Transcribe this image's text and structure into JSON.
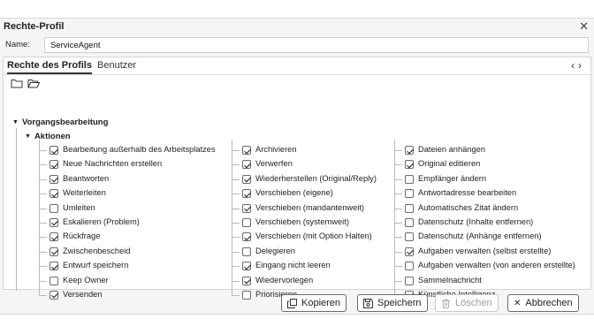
{
  "window": {
    "title": "Rechte-Profil",
    "close_icon": "close-icon"
  },
  "name_field": {
    "label": "Name:",
    "value": "ServiceAgent"
  },
  "tabs": [
    {
      "label": "Rechte des Profils",
      "active": true
    },
    {
      "label": "Benutzer",
      "active": false
    }
  ],
  "nav": {
    "prev": "‹",
    "next": "›"
  },
  "tree": {
    "group": "Vorgangsbearbeitung",
    "subgroup": "Aktionen",
    "columns": [
      [
        {
          "label": "Bearbeitung außerhalb des Arbeitsplatzes",
          "checked": true
        },
        {
          "label": "Neue Nachrichten erstellen",
          "checked": true
        },
        {
          "label": "Beantworten",
          "checked": true
        },
        {
          "label": "Weiterleiten",
          "checked": true
        },
        {
          "label": "Umleiten",
          "checked": false
        },
        {
          "label": "Eskalieren (Problem)",
          "checked": true
        },
        {
          "label": "Rückfrage",
          "checked": true
        },
        {
          "label": "Zwischenbescheid",
          "checked": true
        },
        {
          "label": "Entwurf speichern",
          "checked": true
        },
        {
          "label": "Keep Owner",
          "checked": false
        },
        {
          "label": "Versenden",
          "checked": true
        }
      ],
      [
        {
          "label": "Archivieren",
          "checked": true
        },
        {
          "label": "Verwerfen",
          "checked": true
        },
        {
          "label": "Wiederherstellen (Original/Reply)",
          "checked": true
        },
        {
          "label": "Verschieben (eigene)",
          "checked": true
        },
        {
          "label": "Verschieben (mandantenweit)",
          "checked": true
        },
        {
          "label": "Verschieben (systemweit)",
          "checked": false
        },
        {
          "label": "Verschieben (mit Option Halten)",
          "checked": true
        },
        {
          "label": "Delegieren",
          "checked": false
        },
        {
          "label": "Eingang nicht leeren",
          "checked": true
        },
        {
          "label": "Wiedervorlegen",
          "checked": true
        },
        {
          "label": "Priorisieren",
          "checked": false
        }
      ],
      [
        {
          "label": "Dateien anhängen",
          "checked": true
        },
        {
          "label": "Original editieren",
          "checked": true
        },
        {
          "label": "Empfänger ändern",
          "checked": false
        },
        {
          "label": "Antwortadresse bearbeiten",
          "checked": false
        },
        {
          "label": "Automatisches Zitat ändern",
          "checked": false
        },
        {
          "label": "Datenschutz (Inhalte entfernen)",
          "checked": false
        },
        {
          "label": "Datenschutz (Anhänge entfernen)",
          "checked": false
        },
        {
          "label": "Aufgaben verwalten (selbst erstellte)",
          "checked": true
        },
        {
          "label": "Aufgaben verwalten (von anderen erstellte)",
          "checked": false
        },
        {
          "label": "Sammelnachricht",
          "checked": false
        },
        {
          "label": "Künstliche Intelligenz",
          "checked": true
        }
      ]
    ]
  },
  "buttons": {
    "copy": {
      "label": "Kopieren",
      "icon": "copy-icon"
    },
    "save": {
      "label": "Speichern",
      "icon": "save-icon"
    },
    "delete": {
      "label": "Löschen",
      "icon": "trash-icon",
      "disabled": true
    },
    "cancel": {
      "label": "Abbrechen",
      "icon": "close-icon"
    }
  }
}
